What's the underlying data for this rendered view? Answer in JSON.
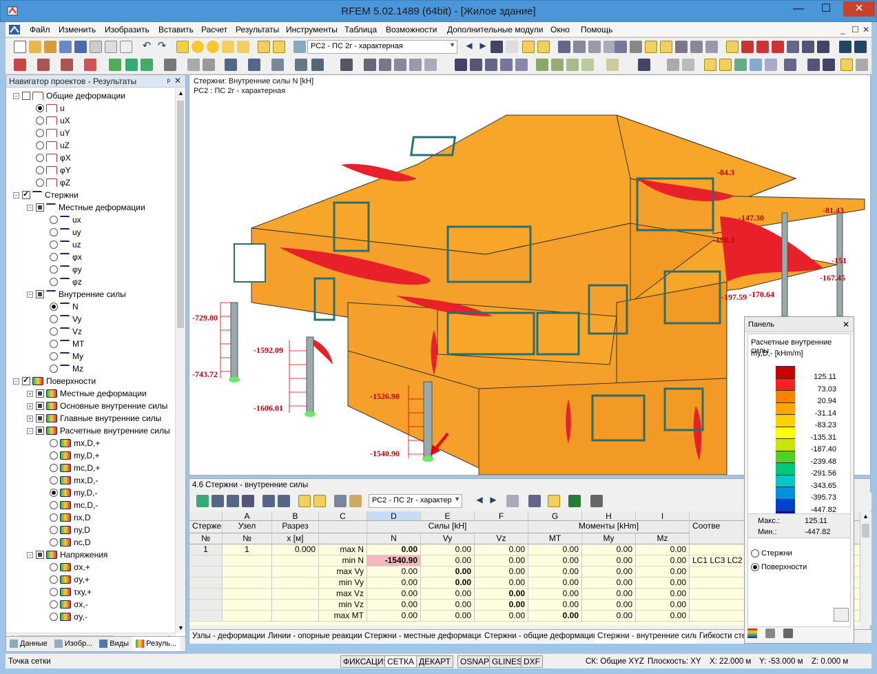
{
  "window": {
    "title": "RFEM 5.02.1489 (64bit) - [Жилое здание]",
    "minimize": "—",
    "maximize": "☐",
    "close": "✕"
  },
  "menu": {
    "items": [
      "Файл",
      "Изменить",
      "Изобразить",
      "Вставить",
      "Расчет",
      "Результаты",
      "Инструменты",
      "Таблица",
      "Возможности",
      "Дополнительные модули",
      "Окно",
      "Помощь"
    ],
    "doc_controls": [
      "_",
      "☐",
      "✕"
    ]
  },
  "toolbar": {
    "load_combo": "РС2 - ПС 2г - характерная"
  },
  "navigator": {
    "title": "Навигатор проектов - Результаты",
    "pin": "ᵖ",
    "close": "✕",
    "tree": [
      {
        "label": "Общие деформации",
        "level": 1,
        "type": "cb",
        "state": "off",
        "exp": "−",
        "icon": "def"
      },
      {
        "label": "u",
        "level": 2,
        "type": "rad",
        "state": "on",
        "icon": "def"
      },
      {
        "label": "uX",
        "level": 2,
        "type": "rad",
        "state": "off",
        "icon": "def"
      },
      {
        "label": "uY",
        "level": 2,
        "type": "rad",
        "state": "off",
        "icon": "def"
      },
      {
        "label": "uZ",
        "level": 2,
        "type": "rad",
        "state": "off",
        "icon": "def"
      },
      {
        "label": "φX",
        "level": 2,
        "type": "rad",
        "state": "off",
        "icon": "def"
      },
      {
        "label": "φY",
        "level": 2,
        "type": "rad",
        "state": "off",
        "icon": "def"
      },
      {
        "label": "φZ",
        "level": 2,
        "type": "rad",
        "state": "off",
        "icon": "def"
      },
      {
        "label": "Стержни",
        "level": 1,
        "type": "cb",
        "state": "on",
        "exp": "−",
        "icon": "bar"
      },
      {
        "label": "Местные деформации",
        "level": 2,
        "type": "cb",
        "state": "part",
        "exp": "−",
        "icon": "bar"
      },
      {
        "label": "ux",
        "level": 3,
        "type": "rad",
        "state": "off",
        "icon": "bar"
      },
      {
        "label": "uy",
        "level": 3,
        "type": "rad",
        "state": "off",
        "icon": "bar"
      },
      {
        "label": "uz",
        "level": 3,
        "type": "rad",
        "state": "off",
        "icon": "bar"
      },
      {
        "label": "φx",
        "level": 3,
        "type": "rad",
        "state": "off",
        "icon": "bar"
      },
      {
        "label": "φy",
        "level": 3,
        "type": "rad",
        "state": "off",
        "icon": "bar"
      },
      {
        "label": "φz",
        "level": 3,
        "type": "rad",
        "state": "off",
        "icon": "bar"
      },
      {
        "label": "Внутренние силы",
        "level": 2,
        "type": "cb",
        "state": "part",
        "exp": "−",
        "icon": "bar"
      },
      {
        "label": "N",
        "level": 3,
        "type": "rad",
        "state": "on",
        "icon": "bar"
      },
      {
        "label": "Vy",
        "level": 3,
        "type": "rad",
        "state": "off",
        "icon": "bar"
      },
      {
        "label": "Vz",
        "level": 3,
        "type": "rad",
        "state": "off",
        "icon": "bar"
      },
      {
        "label": "MT",
        "level": 3,
        "type": "rad",
        "state": "off",
        "icon": "bar"
      },
      {
        "label": "My",
        "level": 3,
        "type": "rad",
        "state": "off",
        "icon": "bar"
      },
      {
        "label": "Mz",
        "level": 3,
        "type": "rad",
        "state": "off",
        "icon": "bar"
      },
      {
        "label": "Поверхности",
        "level": 1,
        "type": "cb",
        "state": "on",
        "exp": "−",
        "icon": "surf"
      },
      {
        "label": "Местные деформации",
        "level": 2,
        "type": "cb",
        "state": "part",
        "exp": "+",
        "icon": "surf"
      },
      {
        "label": "Основные внутренние силы",
        "level": 2,
        "type": "cb",
        "state": "part",
        "exp": "+",
        "icon": "surf"
      },
      {
        "label": "Главные внутренние силы",
        "level": 2,
        "type": "cb",
        "state": "part",
        "exp": "+",
        "icon": "surf"
      },
      {
        "label": "Расчетные внутренние силы",
        "level": 2,
        "type": "cb",
        "state": "part",
        "exp": "−",
        "icon": "surf"
      },
      {
        "label": "mx,D,+",
        "level": 3,
        "type": "rad",
        "state": "off",
        "icon": "surf"
      },
      {
        "label": "my,D,+",
        "level": 3,
        "type": "rad",
        "state": "off",
        "icon": "surf"
      },
      {
        "label": "mc,D,+",
        "level": 3,
        "type": "rad",
        "state": "off",
        "icon": "surf"
      },
      {
        "label": "mx,D,-",
        "level": 3,
        "type": "rad",
        "state": "off",
        "icon": "surf"
      },
      {
        "label": "my,D,-",
        "level": 3,
        "type": "rad",
        "state": "on",
        "icon": "surf"
      },
      {
        "label": "mc,D,-",
        "level": 3,
        "type": "rad",
        "state": "off",
        "icon": "surf"
      },
      {
        "label": "nx,D",
        "level": 3,
        "type": "rad",
        "state": "off",
        "icon": "surf"
      },
      {
        "label": "ny,D",
        "level": 3,
        "type": "rad",
        "state": "off",
        "icon": "surf"
      },
      {
        "label": "nc,D",
        "level": 3,
        "type": "rad",
        "state": "off",
        "icon": "surf"
      },
      {
        "label": "Напряжения",
        "level": 2,
        "type": "cb",
        "state": "part",
        "exp": "−",
        "icon": "surf"
      },
      {
        "label": "σx,+",
        "level": 3,
        "type": "rad",
        "state": "off",
        "icon": "surf"
      },
      {
        "label": "σy,+",
        "level": 3,
        "type": "rad",
        "state": "off",
        "icon": "surf"
      },
      {
        "label": "τxy,+",
        "level": 3,
        "type": "rad",
        "state": "off",
        "icon": "surf"
      },
      {
        "label": "σx,-",
        "level": 3,
        "type": "rad",
        "state": "off",
        "icon": "surf"
      },
      {
        "label": "σy,-",
        "level": 3,
        "type": "rad",
        "state": "off",
        "icon": "surf"
      }
    ],
    "tabs": [
      "Данные",
      "Изобр...",
      "Виды",
      "Резуль..."
    ]
  },
  "view": {
    "caption1": "Стержни: Внутренние силы N [kH]",
    "caption2": "РС2 : ПС 2г - характерная",
    "labels": [
      "-729.80",
      "-743.72",
      "-1592.09",
      "-1606.01",
      "-1526.98",
      "-1540.90",
      "-84.3",
      "-81.43",
      "-147.30",
      "-190.3",
      "-167.45",
      "-197.59",
      "-170.64",
      "-151"
    ]
  },
  "panel": {
    "title": "Панель",
    "close": "✕",
    "heading": "Расчетные внутренние силы",
    "unit": "my,D,- [kHm/m]",
    "values": [
      "125.11",
      "73.03",
      "20.94",
      "-31.14",
      "-83.23",
      "-135.31",
      "-187.40",
      "-239.48",
      "-291.56",
      "-343.65",
      "-395.73",
      "-447.82"
    ],
    "colors": [
      "#c80000",
      "#ff2020",
      "#ff8000",
      "#ffa500",
      "#ffd000",
      "#ffff00",
      "#c8e600",
      "#50d020",
      "#00c878",
      "#00c8c8",
      "#0090e0",
      "#0040d0",
      "#1010a0"
    ],
    "max_label": "Макс.:",
    "max_value": "125.11",
    "min_label": "Мин.:",
    "min_value": "-447.82",
    "opt1": "Стержни",
    "opt2": "Поверхности"
  },
  "table": {
    "title": "4.6 Стержни - внутренние силы",
    "combo": "РС2 - ПС 2г - характер",
    "cols": [
      "A",
      "B",
      "C",
      "D",
      "E",
      "F",
      "G",
      "H",
      "I"
    ],
    "head1": {
      "rod": "Стержень",
      "node": "Узел",
      "section": "Разрез",
      "forces": "Силы [kH]",
      "moments": "Моменты [kHm]",
      "corr": "Соотве"
    },
    "head2": {
      "rod": "№",
      "node": "№",
      "section": "x [м]",
      "N": "N",
      "Vy": "Vy",
      "Vz": "Vz",
      "MT": "MT",
      "My": "My",
      "Mz": "Mz"
    },
    "rows": [
      {
        "rod": "1",
        "node": "1",
        "x": "0.000",
        "type": "max N",
        "N": "0.00",
        "Vy": "0.00",
        "Vz": "0.00",
        "MT": "0.00",
        "My": "0.00",
        "Mz": "0.00",
        "corr": ""
      },
      {
        "rod": "",
        "node": "",
        "x": "",
        "type": "min N",
        "N": "-1540.90",
        "Vy": "0.00",
        "Vz": "0.00",
        "MT": "0.00",
        "My": "0.00",
        "Mz": "0.00",
        "corr": "LC1 LC3 LC2"
      },
      {
        "rod": "",
        "node": "",
        "x": "",
        "type": "max Vy",
        "N": "0.00",
        "Vy": "0.00",
        "Vz": "0.00",
        "MT": "0.00",
        "My": "0.00",
        "Mz": "0.00",
        "corr": ""
      },
      {
        "rod": "",
        "node": "",
        "x": "",
        "type": "min Vy",
        "N": "0.00",
        "Vy": "0.00",
        "Vz": "0.00",
        "MT": "0.00",
        "My": "0.00",
        "Mz": "0.00",
        "corr": ""
      },
      {
        "rod": "",
        "node": "",
        "x": "",
        "type": "max Vz",
        "N": "0.00",
        "Vy": "0.00",
        "Vz": "0.00",
        "MT": "0.00",
        "My": "0.00",
        "Mz": "0.00",
        "corr": ""
      },
      {
        "rod": "",
        "node": "",
        "x": "",
        "type": "min Vz",
        "N": "0.00",
        "Vy": "0.00",
        "Vz": "0.00",
        "MT": "0.00",
        "My": "0.00",
        "Mz": "0.00",
        "corr": ""
      },
      {
        "rod": "",
        "node": "",
        "x": "",
        "type": "max MT",
        "N": "0.00",
        "Vy": "0.00",
        "Vz": "0.00",
        "MT": "0.00",
        "My": "0.00",
        "Mz": "0.00",
        "corr": ""
      }
    ],
    "tabs": [
      "Узлы - деформации",
      "Линии - опорные реакции",
      "Стержни - местные деформации",
      "Стержни - общие деформации",
      "Стержни - внутренние силы",
      "Гибкости сте"
    ]
  },
  "status": {
    "left": "Точка сетки",
    "buttons": [
      "ФИКСАЦИЯ",
      "СЕТКА",
      "ДЕКАРТ",
      "OSNAP",
      "GLINES",
      "DXF"
    ],
    "cs": "СК: Общие XYZ",
    "plane": "Плоскость: XY",
    "x": "X:  22.000 м",
    "y": "Y:  -53.000 м",
    "z": "Z:  0.000 м"
  }
}
